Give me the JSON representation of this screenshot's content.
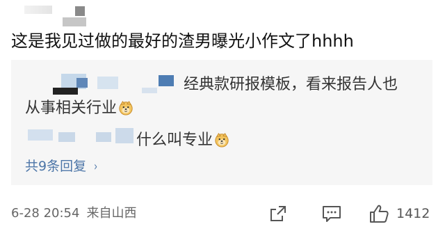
{
  "comment": {
    "text": "这是我见过做的最好的渣男曝光小作文了hhhh"
  },
  "replies": [
    {
      "text_line1": "经典款研报模板，看来报告人也",
      "text_line2": "从事相关行业",
      "emoji": "doge-emoji"
    },
    {
      "text": "什么叫专业",
      "emoji": "doge-emoji"
    }
  ],
  "more_replies": {
    "label": "共9条回复",
    "chevron": "›"
  },
  "footer": {
    "date_time": "6-28 20:54",
    "location": "来自山西",
    "like_count": "1412",
    "icons": [
      "share-icon",
      "comment-icon",
      "like-icon"
    ]
  },
  "colors": {
    "link": "#4d76a8",
    "reply_bg": "#f6f6f6",
    "meta": "#666666"
  }
}
